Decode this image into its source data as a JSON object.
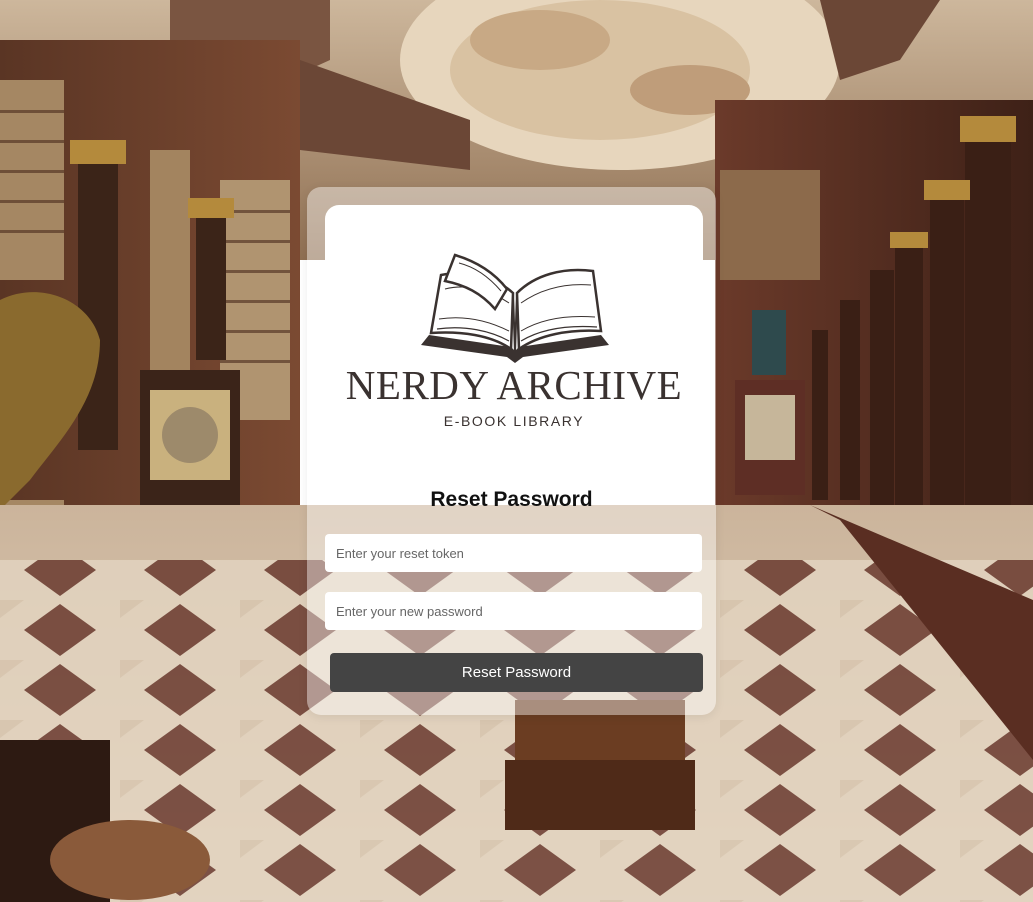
{
  "brand": {
    "name": "NERDY ARCHIVE",
    "tagline": "E-BOOK LIBRARY",
    "logo_icon": "open-book-icon",
    "text_color": "#3a3230"
  },
  "form": {
    "title": "Reset Password",
    "token_placeholder": "Enter your reset token",
    "token_value": "",
    "password_placeholder": "Enter your new password",
    "password_value": "",
    "submit_label": "Reset Password",
    "button_color": "#444444"
  },
  "background": {
    "scene": "baroque-library-hall-photo"
  }
}
